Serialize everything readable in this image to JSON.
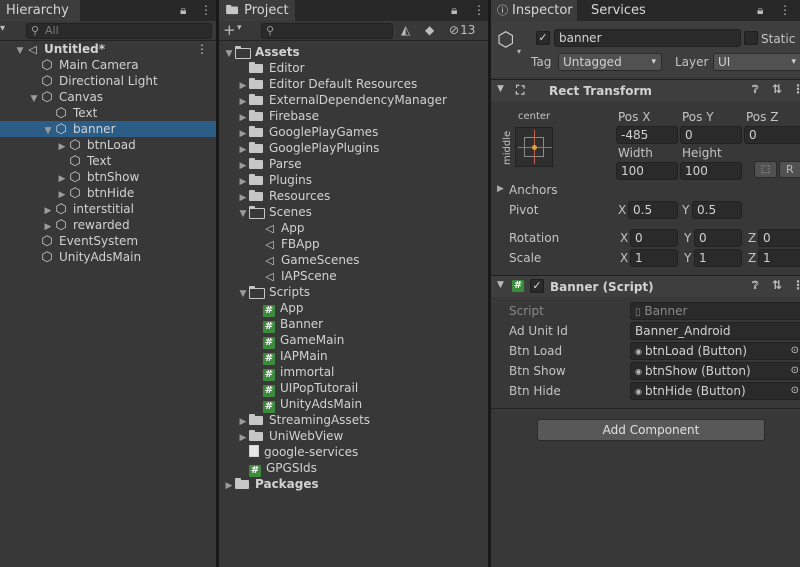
{
  "hierarchy": {
    "tab_label": "Hierarchy",
    "search_placeholder": "All",
    "items": [
      {
        "label": "Untitled*",
        "icon": "unity-scene-icon",
        "depth": 0,
        "expanded": true,
        "bold": true
      },
      {
        "label": "Main Camera",
        "icon": "gameobject-icon",
        "depth": 1
      },
      {
        "label": "Directional Light",
        "icon": "gameobject-icon",
        "depth": 1
      },
      {
        "label": "Canvas",
        "icon": "gameobject-icon",
        "depth": 1,
        "expanded": true
      },
      {
        "label": "Text",
        "icon": "gameobject-icon",
        "depth": 2
      },
      {
        "label": "banner",
        "icon": "gameobject-icon",
        "depth": 2,
        "expanded": true,
        "selected": true
      },
      {
        "label": "btnLoad",
        "icon": "gameobject-icon",
        "depth": 3,
        "collapsed": true
      },
      {
        "label": "Text",
        "icon": "gameobject-icon",
        "depth": 3
      },
      {
        "label": "btnShow",
        "icon": "gameobject-icon",
        "depth": 3,
        "collapsed": true
      },
      {
        "label": "btnHide",
        "icon": "gameobject-icon",
        "depth": 3,
        "collapsed": true
      },
      {
        "label": "interstitial",
        "icon": "gameobject-icon",
        "depth": 2,
        "collapsed": true
      },
      {
        "label": "rewarded",
        "icon": "gameobject-icon",
        "depth": 2,
        "collapsed": true
      },
      {
        "label": "EventSystem",
        "icon": "gameobject-icon",
        "depth": 1
      },
      {
        "label": "UnityAdsMain",
        "icon": "gameobject-icon",
        "depth": 1
      }
    ]
  },
  "project": {
    "tab_label": "Project",
    "hidden_count": "13",
    "items": [
      {
        "label": "Assets",
        "type": "folder-open",
        "depth": 0,
        "expanded": true,
        "bold": true
      },
      {
        "label": "Editor",
        "type": "folder",
        "depth": 1
      },
      {
        "label": "Editor Default Resources",
        "type": "folder",
        "depth": 1,
        "collapsed": true
      },
      {
        "label": "ExternalDependencyManager",
        "type": "folder",
        "depth": 1,
        "collapsed": true
      },
      {
        "label": "Firebase",
        "type": "folder",
        "depth": 1,
        "collapsed": true
      },
      {
        "label": "GooglePlayGames",
        "type": "folder",
        "depth": 1,
        "collapsed": true
      },
      {
        "label": "GooglePlayPlugins",
        "type": "folder",
        "depth": 1,
        "collapsed": true
      },
      {
        "label": "Parse",
        "type": "folder",
        "depth": 1,
        "collapsed": true
      },
      {
        "label": "Plugins",
        "type": "folder",
        "depth": 1,
        "collapsed": true
      },
      {
        "label": "Resources",
        "type": "folder",
        "depth": 1,
        "collapsed": true
      },
      {
        "label": "Scenes",
        "type": "folder-open",
        "depth": 1,
        "expanded": true
      },
      {
        "label": "App",
        "type": "scene",
        "depth": 2
      },
      {
        "label": "FBApp",
        "type": "scene",
        "depth": 2
      },
      {
        "label": "GameScenes",
        "type": "scene",
        "depth": 2
      },
      {
        "label": "IAPScene",
        "type": "scene",
        "depth": 2
      },
      {
        "label": "Scripts",
        "type": "folder-open",
        "depth": 1,
        "expanded": true
      },
      {
        "label": "App",
        "type": "script",
        "depth": 2
      },
      {
        "label": "Banner",
        "type": "script",
        "depth": 2
      },
      {
        "label": "GameMain",
        "type": "script",
        "depth": 2
      },
      {
        "label": "IAPMain",
        "type": "script",
        "depth": 2
      },
      {
        "label": "immortal",
        "type": "script",
        "depth": 2
      },
      {
        "label": "UIPopTutorail",
        "type": "script",
        "depth": 2
      },
      {
        "label": "UnityAdsMain",
        "type": "script",
        "depth": 2
      },
      {
        "label": "StreamingAssets",
        "type": "folder",
        "depth": 1,
        "collapsed": true
      },
      {
        "label": "UniWebView",
        "type": "folder",
        "depth": 1,
        "collapsed": true
      },
      {
        "label": "google-services",
        "type": "document",
        "depth": 1
      },
      {
        "label": "GPGSIds",
        "type": "script",
        "depth": 1
      },
      {
        "label": "Packages",
        "type": "folder",
        "depth": 0,
        "collapsed": true,
        "bold": true
      }
    ]
  },
  "inspector": {
    "tab_label": "Inspector",
    "services_tab_label": "Services",
    "object_name": "banner",
    "static_label": "Static",
    "tag_label": "Tag",
    "tag_value": "Untagged",
    "layer_label": "Layer",
    "layer_value": "UI",
    "rect_transform": {
      "title": "Rect Transform",
      "anchor_preset_top": "center",
      "anchor_preset_side": "middle",
      "pos_x_label": "Pos X",
      "pos_y_label": "Pos Y",
      "pos_z_label": "Pos Z",
      "pos_x": "-485",
      "pos_y": "0",
      "pos_z": "0",
      "width_label": "Width",
      "height_label": "Height",
      "width": "100",
      "height": "100",
      "r_button": "R",
      "anchors_label": "Anchors",
      "pivot_label": "Pivot",
      "pivot_x": "0.5",
      "pivot_y": "0.5",
      "rotation_label": "Rotation",
      "rot_x": "0",
      "rot_y": "0",
      "rot_z": "0",
      "scale_label": "Scale",
      "scale_x": "1",
      "scale_y": "1",
      "scale_z": "1",
      "x_label": "X",
      "y_label": "Y",
      "z_label": "Z"
    },
    "banner_script": {
      "title": "Banner (Script)",
      "script_label": "Script",
      "script_value": "Banner",
      "ad_unit_id_label": "Ad Unit Id",
      "ad_unit_id_value": "Banner_Android",
      "btn_load_label": "Btn Load",
      "btn_load_value": "btnLoad (Button)",
      "btn_show_label": "Btn Show",
      "btn_show_value": "btnShow (Button)",
      "btn_hide_label": "Btn Hide",
      "btn_hide_value": "btnHide (Button)"
    },
    "add_component_label": "Add Component"
  },
  "colors": {
    "selection": "#2c5d87",
    "panel_bg": "#383838",
    "tab_bar": "#282828",
    "script_icon": "#3d8b3d"
  }
}
